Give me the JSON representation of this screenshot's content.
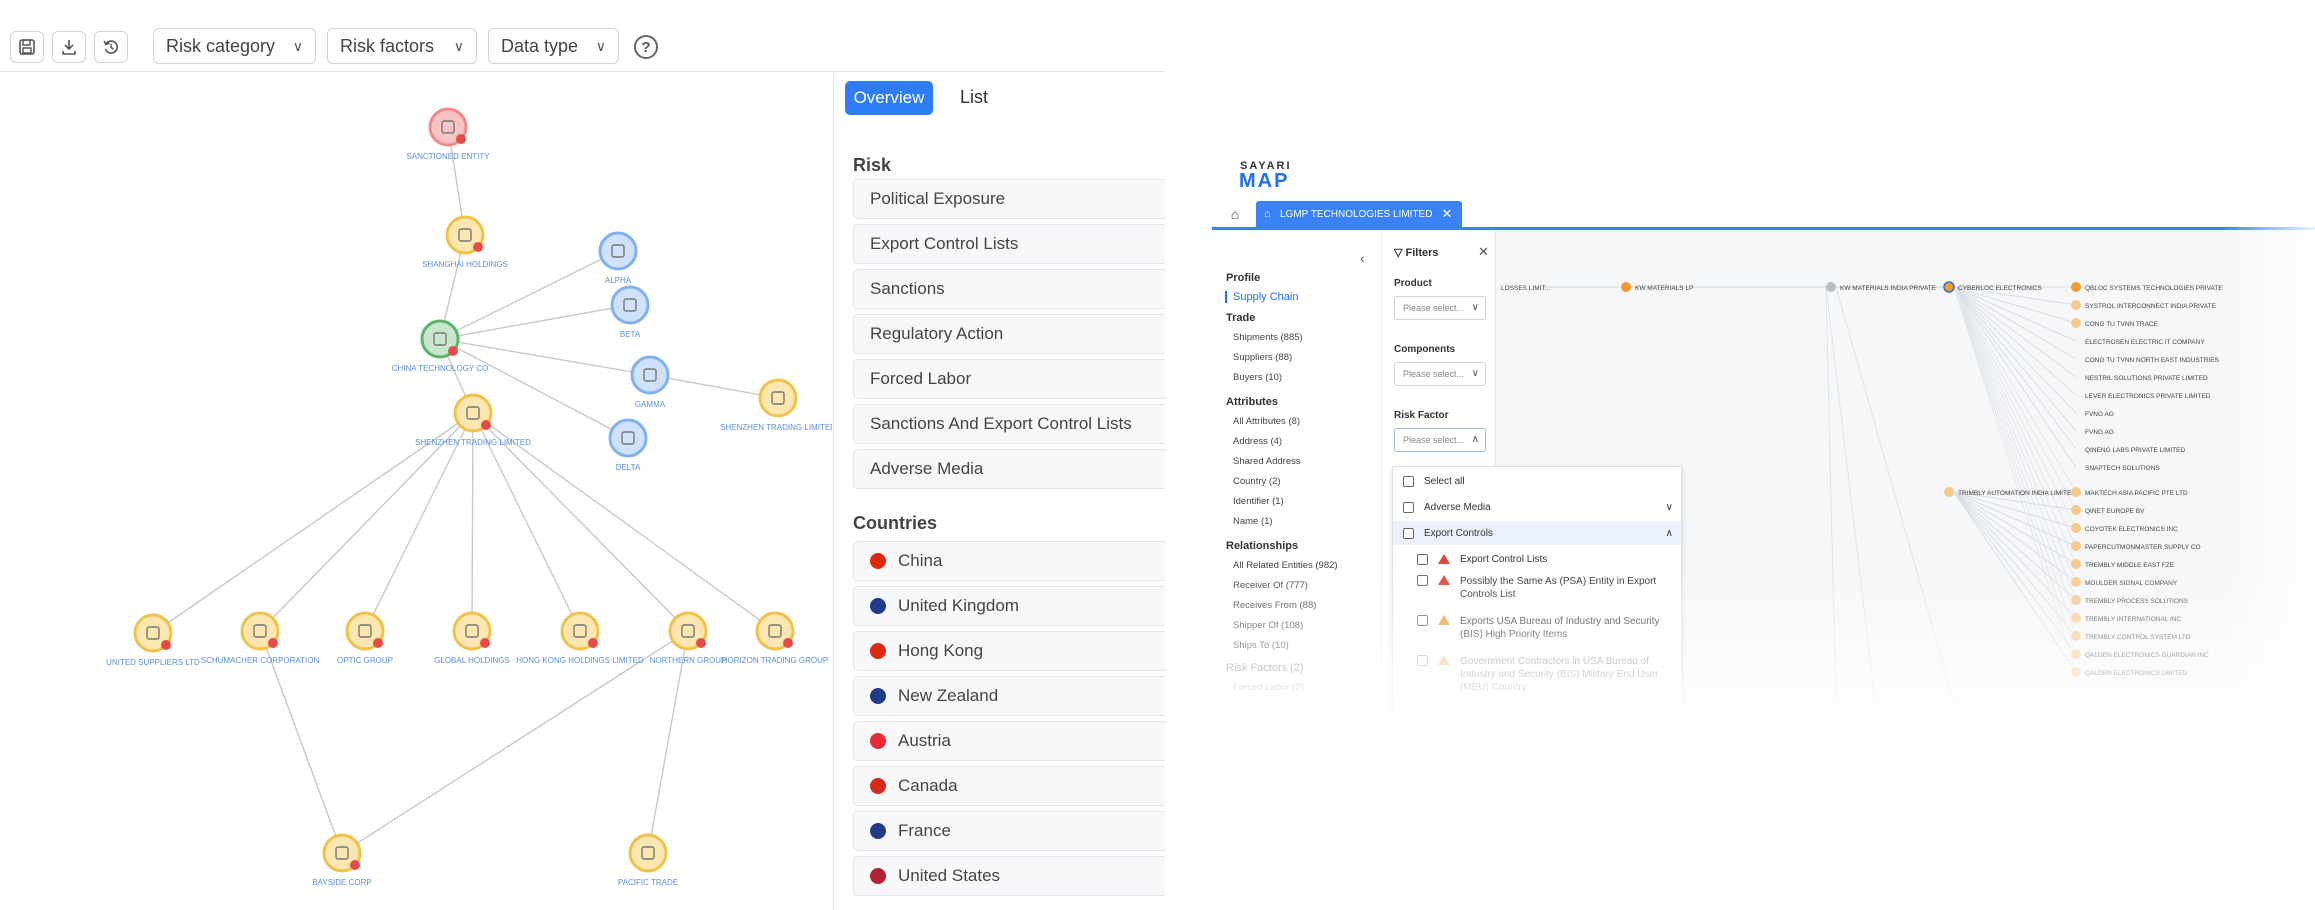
{
  "toolbar": {
    "dropdowns": [
      "Risk category",
      "Risk factors",
      "Data type"
    ]
  },
  "graph": {
    "node_labels": [
      "SANCTIONED ENTITY",
      "SHANGHAI HOLDINGS",
      "CHINA TECHNOLOGY CO",
      "SHENZHEN TRADING LIMITED",
      "UNITED SUPPLIERS LTD",
      "SCHUMACHER CORPORATION",
      "OPTIC GROUP",
      "GLOBAL HOLDINGS",
      "HONG KONG HOLDINGS LIMITED",
      "NORTHERN GROUP",
      "HORIZON TRADING GROUP",
      "BAYSIDE CORP",
      "PACIFIC TRADE",
      "ALPHA",
      "BETA",
      "GAMMA",
      "DELTA"
    ]
  },
  "panel": {
    "tabs": {
      "overview": "Overview",
      "list": "List"
    },
    "risk_title": "Risk",
    "risk_items": [
      "Political Exposure",
      "Export Control Lists",
      "Sanctions",
      "Regulatory Action",
      "Forced Labor",
      "Sanctions And Export Control Lists",
      "Adverse Media"
    ],
    "countries_title": "Countries",
    "countries": [
      {
        "name": "China",
        "color": "#de2910"
      },
      {
        "name": "United Kingdom",
        "color": "#1f3b8a"
      },
      {
        "name": "Hong Kong",
        "color": "#de2910"
      },
      {
        "name": "New Zealand",
        "color": "#1f3b8a"
      },
      {
        "name": "Austria",
        "color": "#ed2939"
      },
      {
        "name": "Canada",
        "color": "#d52b1e"
      },
      {
        "name": "France",
        "color": "#1f3b8a"
      },
      {
        "name": "United States",
        "color": "#b22234"
      }
    ]
  },
  "sayari": {
    "logo_top": "SAYARI",
    "logo_bottom": "MAP",
    "entity_tab": "LGMP TECHNOLOGIES LIMITED",
    "sidebar": {
      "profile": "Profile",
      "supply_chain": "Supply Chain",
      "trade": "Trade",
      "trade_items": [
        "Shipments (885)",
        "Suppliers (88)",
        "Buyers (10)"
      ],
      "attributes": "Attributes",
      "attribute_items": [
        "All Attributes (8)",
        "Address (4)",
        "Shared Address",
        "Country (2)",
        "Identifier (1)",
        "Name (1)"
      ],
      "relationships": "Relationships",
      "relationship_items": [
        "All Related Entities (982)",
        "Receiver Of (777)",
        "Receives From (88)",
        "Shipper Of (108)",
        "Ships To (10)"
      ],
      "risk_factors": "Risk Factors (2)",
      "forced_labor": "Forced Labor (2)"
    },
    "filters": {
      "title": "Filters",
      "product": "Product",
      "components": "Components",
      "risk_factor": "Risk Factor",
      "placeholder": "Please select..."
    },
    "dropdown": {
      "select_all": "Select all",
      "adverse_media": "Adverse Media",
      "export_controls": "Export Controls",
      "items": [
        "Export Control Lists",
        "Possibly the Same As (PSA) Entity in Export Controls List",
        "Exports USA Bureau of Industry and Security (BIS) High Priority Items",
        "Government Contractors in USA Bureau of Industry and Security (BIS) Military End User (MEU) Country"
      ]
    },
    "chain_nodes": [
      "LOSSES LIMIT...",
      "KW MATERIALS LP",
      "KW MATERIALS INDIA PRIVATE",
      "CYBERLOC ELECTRONICS",
      "TRIMBLY AUTOMATION INDIA LIMITED"
    ],
    "right_list": [
      "QBLOC SYSTEMS TECHNOLOGIES PRIVATE",
      "SYSTROL INTERCONNECT INDIA PRIVATE",
      "CONG TU TVNN TRACE",
      "ELECTROSEN ELECTRIC IT COMPANY",
      "CONG TU TVNN NORTH EAST INDUSTRIES",
      "NESTRIL SOLUTIONS PRIVATE LIMITED",
      "LEVER ELECTRONICS PRIVATE LIMITED",
      "FVNG AG",
      "FVNG AG",
      "QINENG LABS PRIVATE LIMITED",
      "SNAPTECH SOLUTIONS",
      "MAKTECH ASIA PACIFIC PTE LTD",
      "QINET EUROPE BV",
      "COYOTEK ELECTRONICS INC",
      "PAPERCUTMONMASTER SUPPLY CO",
      "TREMBLY MIDDLE EAST FZE",
      "MOULDER SIGNAL COMPANY",
      "TREMBLY PROCESS SOLUTIONS",
      "TREMBLY INTERNATIONAL INC",
      "TREMBLY CONTROL SYSTEM LTD",
      "QALDEN ELECTRONICS GUARDIAN INC",
      "QALDEN ELECTRONICS LIMITED"
    ]
  }
}
